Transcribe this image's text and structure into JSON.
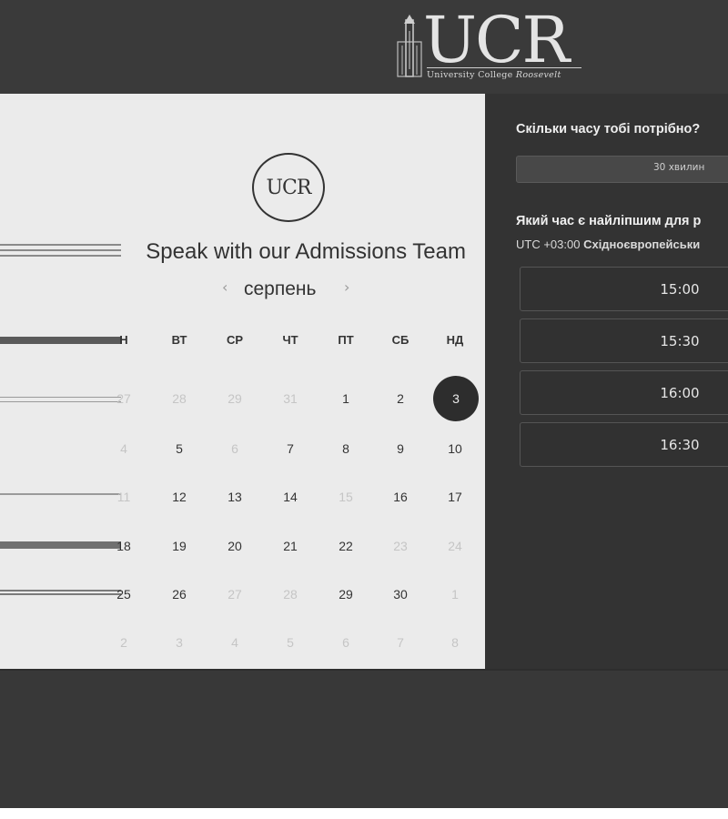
{
  "header": {
    "logo_letters": "UCR",
    "logo_sub_1": "University College ",
    "logo_sub_2": "Roosevelt"
  },
  "card": {
    "logo_text": "UCR",
    "title": "Speak with our Admissions Team",
    "month": "серпень",
    "prev_icon": "‹",
    "next_icon": "›",
    "weekdays": [
      "Н",
      "ВТ",
      "СР",
      "ЧТ",
      "ПТ",
      "СБ",
      "НД"
    ],
    "weeks": [
      [
        {
          "d": "27",
          "m": true
        },
        {
          "d": "28",
          "m": true
        },
        {
          "d": "29",
          "m": true
        },
        {
          "d": "31",
          "m": true
        },
        {
          "d": "1",
          "m": false
        },
        {
          "d": "2",
          "m": false
        },
        {
          "d": "3",
          "m": false,
          "sel": true
        }
      ],
      [
        {
          "d": "4",
          "m": true
        },
        {
          "d": "5",
          "m": false
        },
        {
          "d": "6",
          "m": true
        },
        {
          "d": "7",
          "m": false
        },
        {
          "d": "8",
          "m": false
        },
        {
          "d": "9",
          "m": false
        },
        {
          "d": "10",
          "m": false
        }
      ],
      [
        {
          "d": "11",
          "m": true
        },
        {
          "d": "12",
          "m": false
        },
        {
          "d": "13",
          "m": false
        },
        {
          "d": "14",
          "m": false
        },
        {
          "d": "15",
          "m": true
        },
        {
          "d": "16",
          "m": false
        },
        {
          "d": "17",
          "m": false
        }
      ],
      [
        {
          "d": "18",
          "m": false
        },
        {
          "d": "19",
          "m": false
        },
        {
          "d": "20",
          "m": false
        },
        {
          "d": "21",
          "m": false
        },
        {
          "d": "22",
          "m": false
        },
        {
          "d": "23",
          "m": true
        },
        {
          "d": "24",
          "m": true
        }
      ],
      [
        {
          "d": "25",
          "m": false
        },
        {
          "d": "26",
          "m": false
        },
        {
          "d": "27",
          "m": true
        },
        {
          "d": "28",
          "m": true
        },
        {
          "d": "29",
          "m": false
        },
        {
          "d": "30",
          "m": false
        },
        {
          "d": "1",
          "m": true
        }
      ],
      [
        {
          "d": "2",
          "m": true
        },
        {
          "d": "3",
          "m": true
        },
        {
          "d": "4",
          "m": true
        },
        {
          "d": "5",
          "m": true
        },
        {
          "d": "6",
          "m": true
        },
        {
          "d": "7",
          "m": true
        },
        {
          "d": "8",
          "m": true
        }
      ]
    ]
  },
  "panel": {
    "question_duration": "Скільки часу тобі потрібно?",
    "duration_value": "30 хвилин",
    "question_time": "Який час є найліпшим для р",
    "timezone_prefix": "UTC +03:00 ",
    "timezone_name": "Східноєвропейськи",
    "slots": [
      "15:00",
      "15:30",
      "16:00",
      "16:30"
    ]
  },
  "colors": {
    "header_bg": "#3a3a3a",
    "card_bg": "#ebebeb",
    "panel_bg": "#333333",
    "selected_day": "#2d2d2d"
  }
}
